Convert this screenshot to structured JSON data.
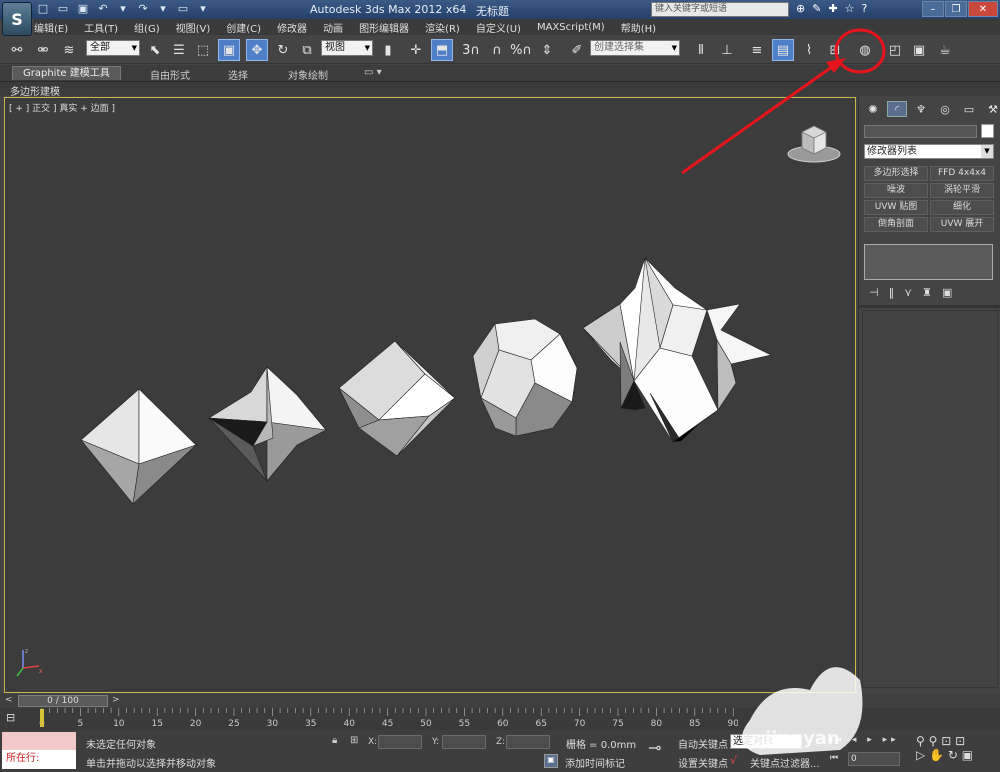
{
  "window": {
    "app_title": "Autodesk 3ds Max  2012 x64",
    "file_name": "无标题",
    "search_placeholder": "键入关键字或短语",
    "help_icon": "?"
  },
  "menu": {
    "items": [
      "编辑(E)",
      "工具(T)",
      "组(G)",
      "视图(V)",
      "创建(C)",
      "修改器",
      "动画",
      "图形编辑器",
      "渲染(R)",
      "自定义(U)",
      "MAXScript(M)",
      "帮助(H)"
    ]
  },
  "toolbar": {
    "selection_filter": "全部",
    "coord_system": "视图",
    "named_selection": "创建选择集",
    "snap_label": "3",
    "percent_snap_label": "%",
    "highlighted_tool": "render-setup-icon"
  },
  "ribbon": {
    "tabs": [
      "Graphite 建模工具",
      "自由形式",
      "选择",
      "对象绘制"
    ],
    "panel_label": "多边形建模"
  },
  "viewport": {
    "label": "[ + ] 正交 ] 真实 + 边面 ]",
    "axis_letters": [
      "z",
      "x"
    ]
  },
  "command_panel": {
    "modifier_list": "修改器列表",
    "modifiers": [
      "多边形选择",
      "FFD 4x4x4",
      "噪波",
      "涡轮平滑",
      "UVW 贴图",
      "细化",
      "倒角剖面",
      "UVW 展开"
    ]
  },
  "timeline": {
    "slider": "0 / 100",
    "ticks": [
      "0",
      "5",
      "10",
      "15",
      "20",
      "25",
      "30",
      "35",
      "40",
      "45",
      "50",
      "55",
      "60",
      "65",
      "70",
      "75",
      "80",
      "85",
      "90"
    ]
  },
  "status": {
    "listener_text": "所在行:",
    "line1": "未选定任何对象",
    "line2": "单击并拖动以选择并移动对象",
    "x_label": "X:",
    "y_label": "Y:",
    "z_label": "Z:",
    "grid": "栅格 = 0.0mm",
    "add_time_tag": "添加时间标记",
    "auto_key": "自动关键点",
    "set_key": "设置关键点",
    "selected_object": "选定对象",
    "key_filters": "关键点过滤器...",
    "frame": "0"
  },
  "watermark": {
    "text": "jingyan"
  },
  "colors": {
    "viewport_bg": "#3c3c3c",
    "viewport_border": "#c8b64a",
    "annotation": "#e8141c",
    "active_tool": "#4f7fc7"
  }
}
